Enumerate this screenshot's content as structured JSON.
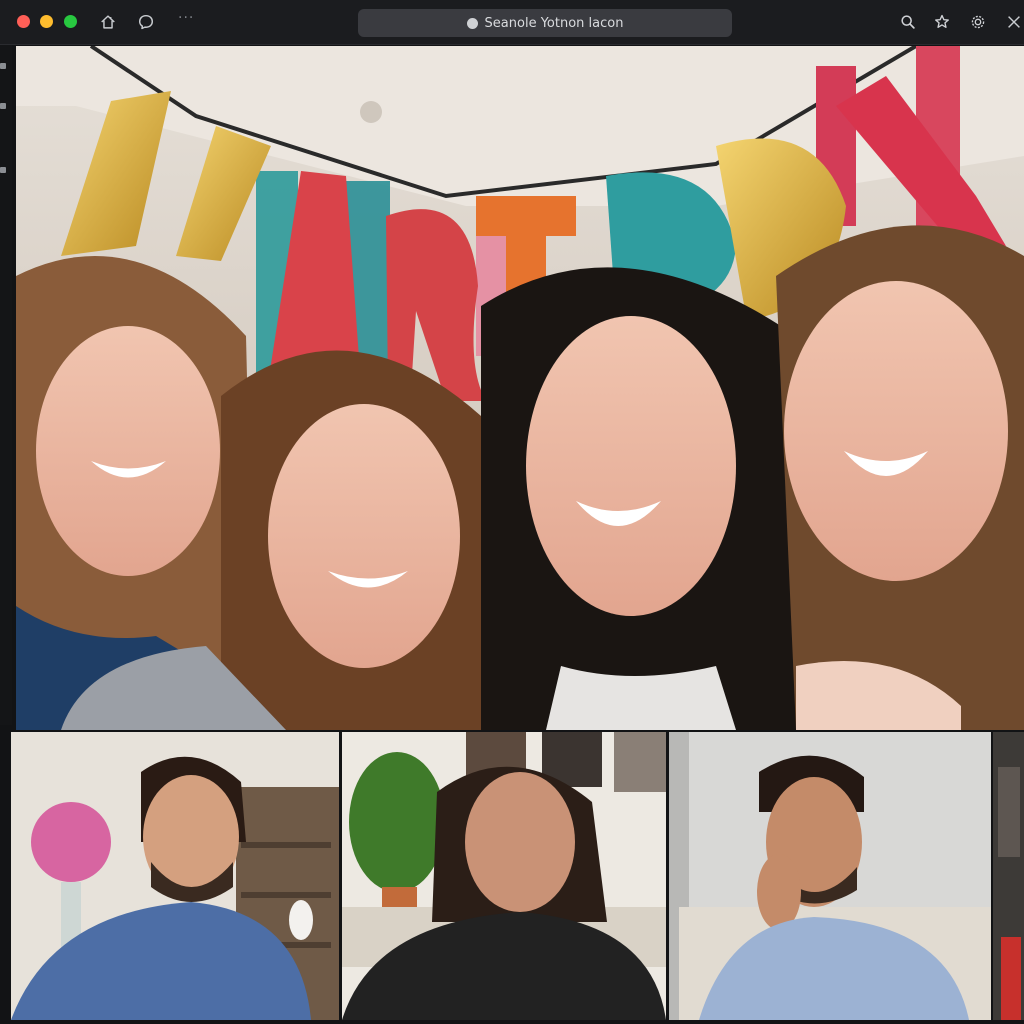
{
  "window": {
    "url_text": "Seanole Yotnon lacon"
  },
  "toolbar": {
    "icons": [
      "home-icon",
      "chat-bubble-icon",
      "more-dots-icon",
      "search-icon",
      "star-icon",
      "settings-gear-icon"
    ],
    "more_dots": "···"
  },
  "main_video": {
    "banner_letters": [
      "A",
      "R",
      "T",
      "D",
      "A",
      "Y"
    ],
    "participant_count": 4
  },
  "thumbnails": [
    {
      "id": "participant-1"
    },
    {
      "id": "participant-2"
    },
    {
      "id": "participant-3"
    },
    {
      "id": "participant-4"
    }
  ],
  "colors": {
    "titlebar": "#1b1c1f",
    "urlbar": "#3a3b40",
    "close": "#ff5f57",
    "minimize": "#febc2e",
    "maximize": "#28c840"
  }
}
